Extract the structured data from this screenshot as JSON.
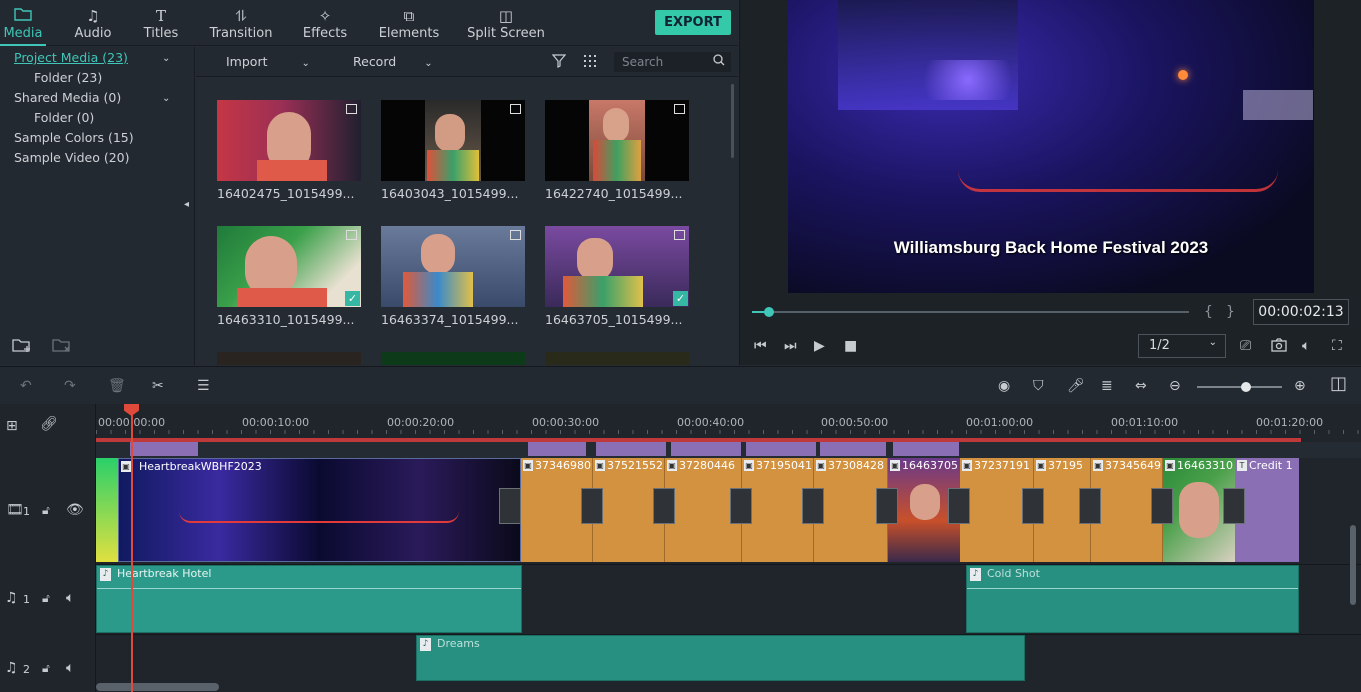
{
  "tabs": [
    {
      "label": "Media",
      "icon": "folder-icon"
    },
    {
      "label": "Audio",
      "icon": "music-note-icon"
    },
    {
      "label": "Titles",
      "icon": "text-icon"
    },
    {
      "label": "Transition",
      "icon": "transition-icon"
    },
    {
      "label": "Effects",
      "icon": "effects-icon"
    },
    {
      "label": "Elements",
      "icon": "elements-icon"
    },
    {
      "label": "Split Screen",
      "icon": "split-screen-icon"
    }
  ],
  "export_label": "EXPORT",
  "tree": [
    {
      "label": "Project Media (23)",
      "selected": true
    },
    {
      "label": "Folder (23)"
    },
    {
      "label": "Shared Media (0)"
    },
    {
      "label": "Folder (0)"
    },
    {
      "label": "Sample Colors (15)"
    },
    {
      "label": "Sample Video (20)"
    }
  ],
  "toolbar": {
    "import": "Import",
    "record": "Record",
    "search_placeholder": "Search"
  },
  "media": [
    {
      "name": "16402475_1015499...",
      "checked": false
    },
    {
      "name": "16403043_1015499...",
      "checked": false
    },
    {
      "name": "16422740_1015499...",
      "checked": false
    },
    {
      "name": "16463310_1015499...",
      "checked": true
    },
    {
      "name": "16463374_1015499...",
      "checked": false
    },
    {
      "name": "16463705_1015499...",
      "checked": true
    }
  ],
  "preview": {
    "caption": "Williamsburg Back Home Festival 2023",
    "timecode": "00:00:02:13",
    "quality": "1/2",
    "progress": 0.04
  },
  "ruler": [
    "00:00:00:00",
    "00:00:10:00",
    "00:00:20:00",
    "00:00:30:00",
    "00:00:40:00",
    "00:00:50:00",
    "00:01:00:00",
    "00:01:10:00",
    "00:01:20:00"
  ],
  "tracks": {
    "video1": "1",
    "audio1": "1",
    "audio2": "2"
  },
  "video_clips": [
    "HeartbreakWBHF2023",
    "37346980",
    "37521552",
    "37280446",
    "37195041",
    "37308428",
    "16463705",
    "37237191",
    "37195",
    "37345649",
    "16463310",
    "Credit 1"
  ],
  "audio_clips": [
    "Heartbreak Hotel",
    "Cold Shot",
    "Dreams"
  ],
  "colors": {
    "accent": "#3fc6b8",
    "export": "#33c9a9",
    "playhead": "#e04a3a",
    "orange_clip": "#d3923f",
    "audio_clip": "#2b9a8a",
    "title_clip": "#8a6fb5"
  }
}
